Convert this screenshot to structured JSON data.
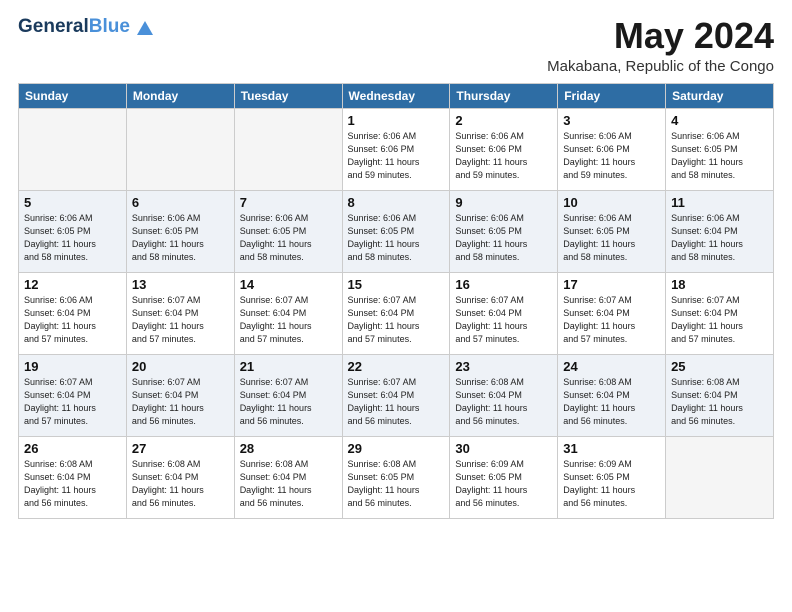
{
  "logo": {
    "general": "General",
    "blue": "Blue",
    "tagline": "GeneralBlue"
  },
  "header": {
    "month": "May 2024",
    "location": "Makabana, Republic of the Congo"
  },
  "weekdays": [
    "Sunday",
    "Monday",
    "Tuesday",
    "Wednesday",
    "Thursday",
    "Friday",
    "Saturday"
  ],
  "weeks": [
    [
      {
        "day": "",
        "info": ""
      },
      {
        "day": "",
        "info": ""
      },
      {
        "day": "",
        "info": ""
      },
      {
        "day": "1",
        "info": "Sunrise: 6:06 AM\nSunset: 6:06 PM\nDaylight: 11 hours\nand 59 minutes."
      },
      {
        "day": "2",
        "info": "Sunrise: 6:06 AM\nSunset: 6:06 PM\nDaylight: 11 hours\nand 59 minutes."
      },
      {
        "day": "3",
        "info": "Sunrise: 6:06 AM\nSunset: 6:06 PM\nDaylight: 11 hours\nand 59 minutes."
      },
      {
        "day": "4",
        "info": "Sunrise: 6:06 AM\nSunset: 6:05 PM\nDaylight: 11 hours\nand 58 minutes."
      }
    ],
    [
      {
        "day": "5",
        "info": "Sunrise: 6:06 AM\nSunset: 6:05 PM\nDaylight: 11 hours\nand 58 minutes."
      },
      {
        "day": "6",
        "info": "Sunrise: 6:06 AM\nSunset: 6:05 PM\nDaylight: 11 hours\nand 58 minutes."
      },
      {
        "day": "7",
        "info": "Sunrise: 6:06 AM\nSunset: 6:05 PM\nDaylight: 11 hours\nand 58 minutes."
      },
      {
        "day": "8",
        "info": "Sunrise: 6:06 AM\nSunset: 6:05 PM\nDaylight: 11 hours\nand 58 minutes."
      },
      {
        "day": "9",
        "info": "Sunrise: 6:06 AM\nSunset: 6:05 PM\nDaylight: 11 hours\nand 58 minutes."
      },
      {
        "day": "10",
        "info": "Sunrise: 6:06 AM\nSunset: 6:05 PM\nDaylight: 11 hours\nand 58 minutes."
      },
      {
        "day": "11",
        "info": "Sunrise: 6:06 AM\nSunset: 6:04 PM\nDaylight: 11 hours\nand 58 minutes."
      }
    ],
    [
      {
        "day": "12",
        "info": "Sunrise: 6:06 AM\nSunset: 6:04 PM\nDaylight: 11 hours\nand 57 minutes."
      },
      {
        "day": "13",
        "info": "Sunrise: 6:07 AM\nSunset: 6:04 PM\nDaylight: 11 hours\nand 57 minutes."
      },
      {
        "day": "14",
        "info": "Sunrise: 6:07 AM\nSunset: 6:04 PM\nDaylight: 11 hours\nand 57 minutes."
      },
      {
        "day": "15",
        "info": "Sunrise: 6:07 AM\nSunset: 6:04 PM\nDaylight: 11 hours\nand 57 minutes."
      },
      {
        "day": "16",
        "info": "Sunrise: 6:07 AM\nSunset: 6:04 PM\nDaylight: 11 hours\nand 57 minutes."
      },
      {
        "day": "17",
        "info": "Sunrise: 6:07 AM\nSunset: 6:04 PM\nDaylight: 11 hours\nand 57 minutes."
      },
      {
        "day": "18",
        "info": "Sunrise: 6:07 AM\nSunset: 6:04 PM\nDaylight: 11 hours\nand 57 minutes."
      }
    ],
    [
      {
        "day": "19",
        "info": "Sunrise: 6:07 AM\nSunset: 6:04 PM\nDaylight: 11 hours\nand 57 minutes."
      },
      {
        "day": "20",
        "info": "Sunrise: 6:07 AM\nSunset: 6:04 PM\nDaylight: 11 hours\nand 56 minutes."
      },
      {
        "day": "21",
        "info": "Sunrise: 6:07 AM\nSunset: 6:04 PM\nDaylight: 11 hours\nand 56 minutes."
      },
      {
        "day": "22",
        "info": "Sunrise: 6:07 AM\nSunset: 6:04 PM\nDaylight: 11 hours\nand 56 minutes."
      },
      {
        "day": "23",
        "info": "Sunrise: 6:08 AM\nSunset: 6:04 PM\nDaylight: 11 hours\nand 56 minutes."
      },
      {
        "day": "24",
        "info": "Sunrise: 6:08 AM\nSunset: 6:04 PM\nDaylight: 11 hours\nand 56 minutes."
      },
      {
        "day": "25",
        "info": "Sunrise: 6:08 AM\nSunset: 6:04 PM\nDaylight: 11 hours\nand 56 minutes."
      }
    ],
    [
      {
        "day": "26",
        "info": "Sunrise: 6:08 AM\nSunset: 6:04 PM\nDaylight: 11 hours\nand 56 minutes."
      },
      {
        "day": "27",
        "info": "Sunrise: 6:08 AM\nSunset: 6:04 PM\nDaylight: 11 hours\nand 56 minutes."
      },
      {
        "day": "28",
        "info": "Sunrise: 6:08 AM\nSunset: 6:04 PM\nDaylight: 11 hours\nand 56 minutes."
      },
      {
        "day": "29",
        "info": "Sunrise: 6:08 AM\nSunset: 6:05 PM\nDaylight: 11 hours\nand 56 minutes."
      },
      {
        "day": "30",
        "info": "Sunrise: 6:09 AM\nSunset: 6:05 PM\nDaylight: 11 hours\nand 56 minutes."
      },
      {
        "day": "31",
        "info": "Sunrise: 6:09 AM\nSunset: 6:05 PM\nDaylight: 11 hours\nand 56 minutes."
      },
      {
        "day": "",
        "info": ""
      }
    ]
  ]
}
